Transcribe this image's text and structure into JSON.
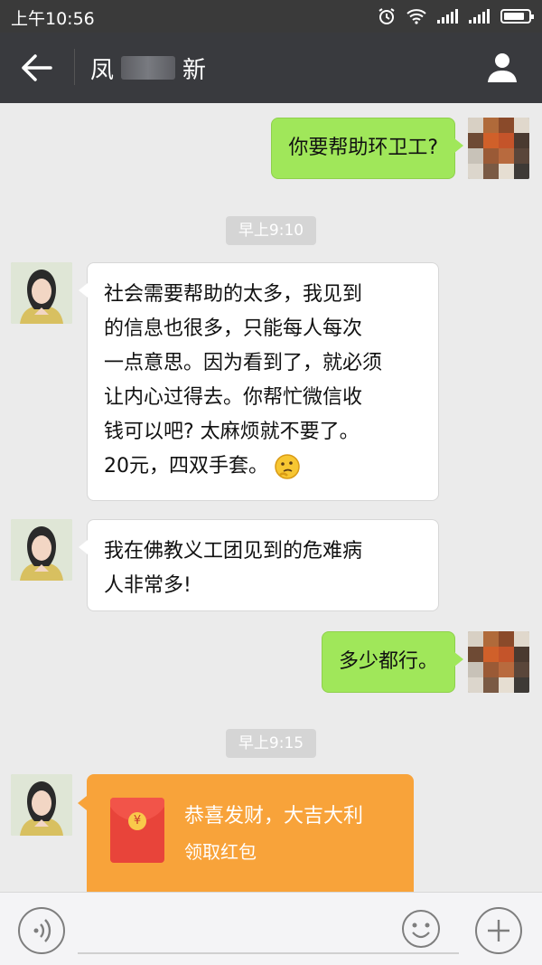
{
  "status_bar": {
    "time": "上午10:56",
    "icons": [
      "alarm-icon",
      "wifi-icon",
      "signal-icon",
      "signal-icon",
      "battery-icon"
    ],
    "battery_level": 0.85
  },
  "nav": {
    "title_left": "凤",
    "title_right": "新",
    "icons": [
      "back-arrow-icon",
      "profile-icon"
    ]
  },
  "messages": [
    {
      "sender": "me",
      "lines": [
        "你要帮助环卫工?"
      ]
    },
    {
      "type": "timestamp",
      "text": "早上9:10"
    },
    {
      "sender": "her",
      "lines": [
        "社会需要帮助的太多，我见到",
        "的信息也很多，只能每人每次",
        "一点意思。因为看到了，就必须",
        "让内心过得去。你帮忙微信收",
        "钱可以吧? 太麻烦就不要了。",
        "20元，四双手套。"
      ],
      "emoji": "thinking-face-emoji"
    },
    {
      "sender": "her",
      "lines": [
        "我在佛教义工团见到的危难病",
        "人非常多!"
      ]
    },
    {
      "sender": "me",
      "lines": [
        "多少都行。"
      ]
    },
    {
      "type": "timestamp",
      "text": "早上9:15"
    },
    {
      "sender": "her",
      "type": "red_packet",
      "greeting": "恭喜发财，大吉大利",
      "action": "领取红包",
      "icon": "red-packet-icon"
    }
  ],
  "input_bar": {
    "placeholder": "",
    "icons": [
      "voice-icon",
      "emoji-icon",
      "plus-icon"
    ]
  },
  "colors": {
    "status_bar": "#3a3a3a",
    "nav_bar": "#393a3e",
    "chat_background": "#ebebeb",
    "my_bubble": "#a0e75a",
    "their_bubble": "#ffffff",
    "red_packet": "#f8a33a"
  }
}
